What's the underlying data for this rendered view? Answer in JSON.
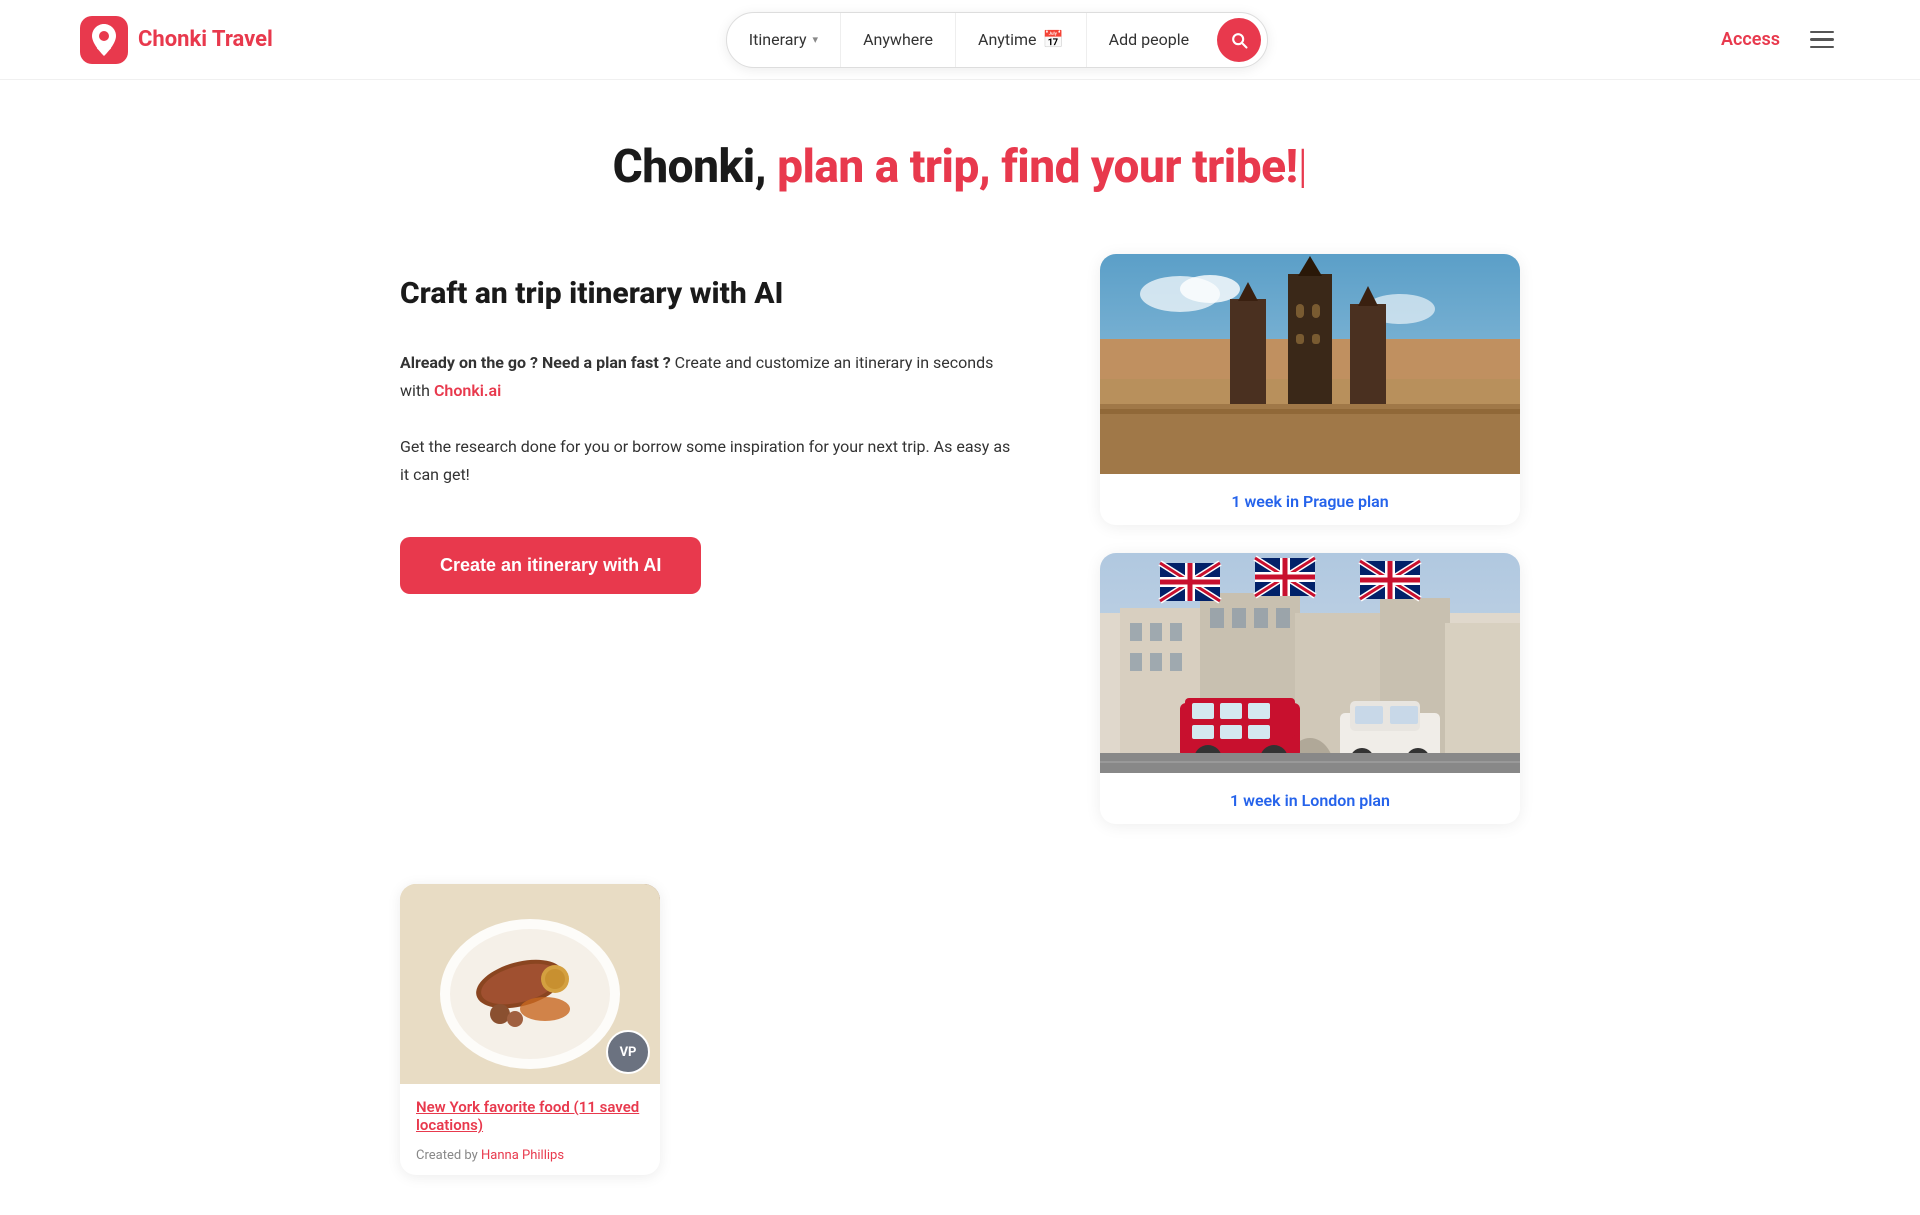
{
  "header": {
    "logo_text": "Chonki Travel",
    "search": {
      "itinerary_label": "Itinerary",
      "anywhere_label": "Anywhere",
      "anytime_label": "Anytime",
      "add_people_label": "Add people"
    },
    "access_label": "Access",
    "menu_aria": "Menu"
  },
  "hero": {
    "title_static": "Chonki,",
    "title_dynamic": "plan a trip, find your tribe!",
    "cursor": "|"
  },
  "left_section": {
    "section_title": "Craft an trip itinerary with AI",
    "desc1_bold": "Already on the go ? Need a plan fast ?",
    "desc1_rest": " Create and customize an itinerary in seconds with",
    "desc1_link": "Chonki.ai",
    "desc2": "Get the research done for you or borrow some inspiration for your next trip. As easy as it can get!",
    "cta_label": "Create an itinerary with AI"
  },
  "right_cards": [
    {
      "label": "1 week in Prague plan",
      "type": "prague"
    },
    {
      "label": "1 week in London plan",
      "type": "london"
    }
  ],
  "bottom_card": {
    "label": "New York favorite food (11 saved locations)",
    "created_by_text": "Created by",
    "author": "Hanna Phillips",
    "avatar_initials": "VP"
  }
}
